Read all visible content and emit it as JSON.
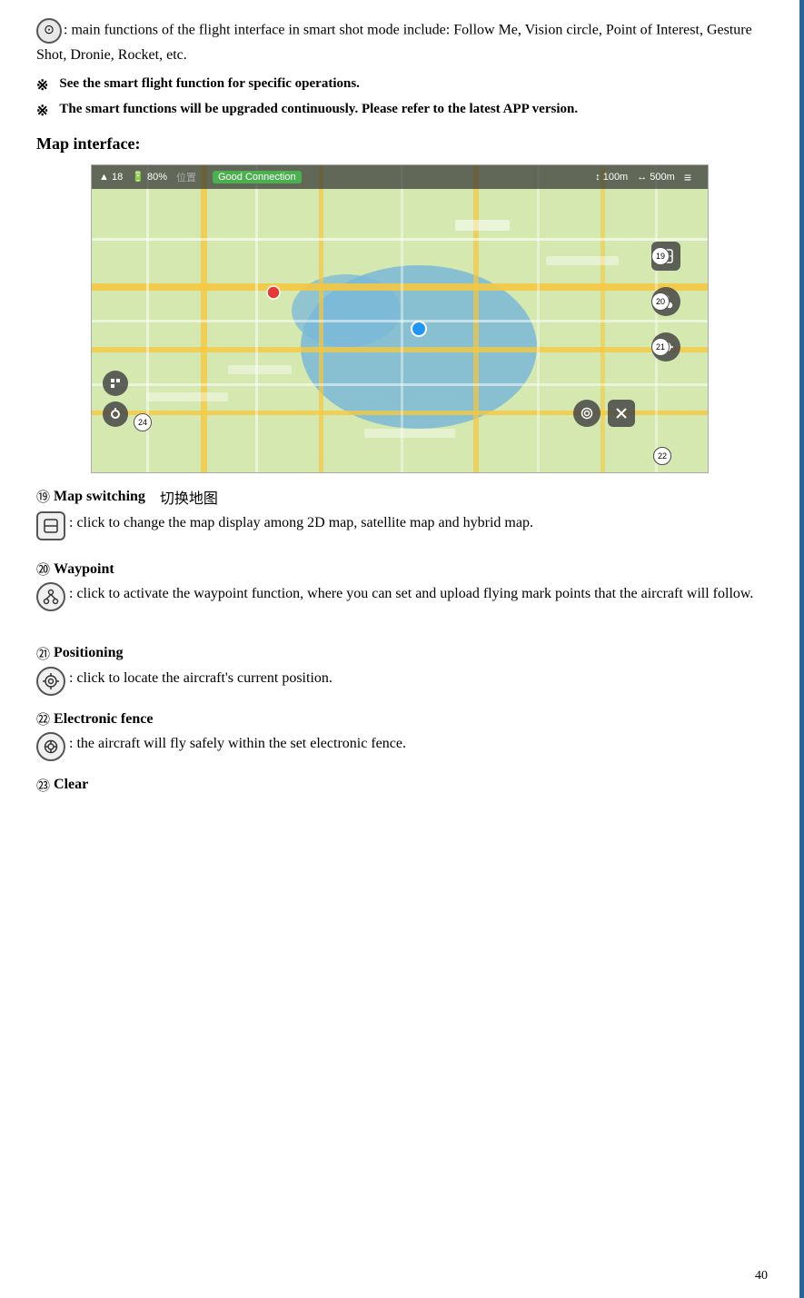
{
  "page": {
    "number": "40"
  },
  "intro": {
    "icon_symbol": "⊙",
    "text": ": main functions of the flight interface in smart shot mode include: Follow Me, Vision circle, Point of Interest, Gesture Shot, Dronie, Rocket, etc."
  },
  "notes": [
    {
      "id": "note1",
      "mark": "※",
      "text": "See the smart flight function for specific operations."
    },
    {
      "id": "note2",
      "mark": "※",
      "text": "The smart functions will be upgraded continuously. Please refer to the latest APP version."
    }
  ],
  "map_interface": {
    "heading": "Map interface:",
    "topbar": {
      "signal": "18",
      "battery": "80%",
      "connection": "Good Connection",
      "altitude": "100m",
      "distance": "500m"
    },
    "numbered_items": {
      "19": "Map switching button",
      "20": "Waypoint button",
      "21": "Positioning button",
      "22": "Electronic fence button",
      "23": "Clear button",
      "24": "Left control"
    }
  },
  "sections": [
    {
      "id": "sec19",
      "number": "⑲",
      "title": "Map switching",
      "chinese": "切换地图",
      "icon_type": "square",
      "desc": ": click to change the map display among 2D map, satellite map and hybrid map."
    },
    {
      "id": "sec20",
      "number": "⑳",
      "title": "Waypoint",
      "chinese": "",
      "icon_type": "circle-node",
      "desc": ": click to activate the waypoint function, where you can set and upload flying mark points that the aircraft will follow."
    },
    {
      "id": "sec21",
      "number": "㉑",
      "title": "Positioning",
      "chinese": "",
      "icon_type": "crosshair",
      "desc": ": click to locate the aircraft's current position."
    },
    {
      "id": "sec22",
      "number": "㉒",
      "title": "Electronic fence",
      "chinese": "",
      "icon_type": "shield",
      "desc": ": the aircraft will fly safely within the set electronic fence."
    },
    {
      "id": "sec23",
      "number": "㉓",
      "title": "Clear",
      "chinese": "",
      "icon_type": "clear",
      "desc": ""
    }
  ]
}
